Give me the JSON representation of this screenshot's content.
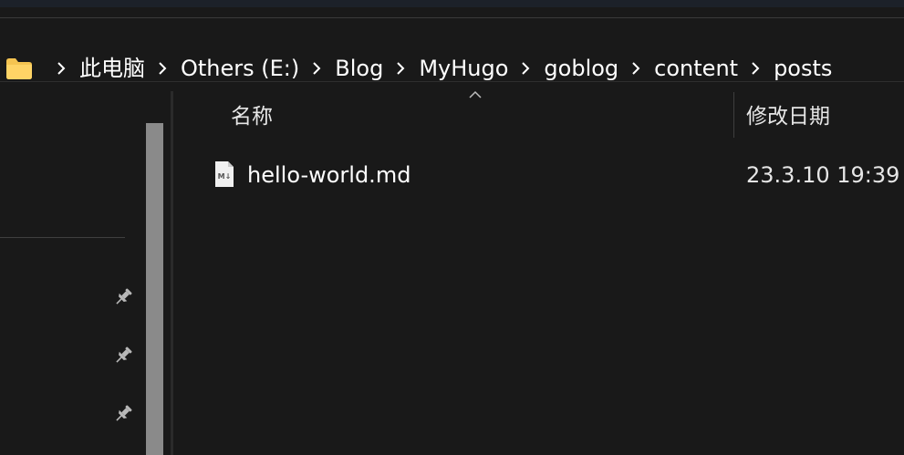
{
  "breadcrumb": {
    "items": [
      "此电脑",
      "Others (E:)",
      "Blog",
      "MyHugo",
      "goblog",
      "content",
      "posts"
    ],
    "folder_color": "#f5c451"
  },
  "columns": {
    "name": "名称",
    "date": "修改日期"
  },
  "files": [
    {
      "name": "hello-world.md",
      "date": "23.3.10 19:39",
      "icon": "markdown-file-icon"
    }
  ],
  "nav": {
    "pins": [
      "pin-icon",
      "pin-icon",
      "pin-icon"
    ]
  }
}
